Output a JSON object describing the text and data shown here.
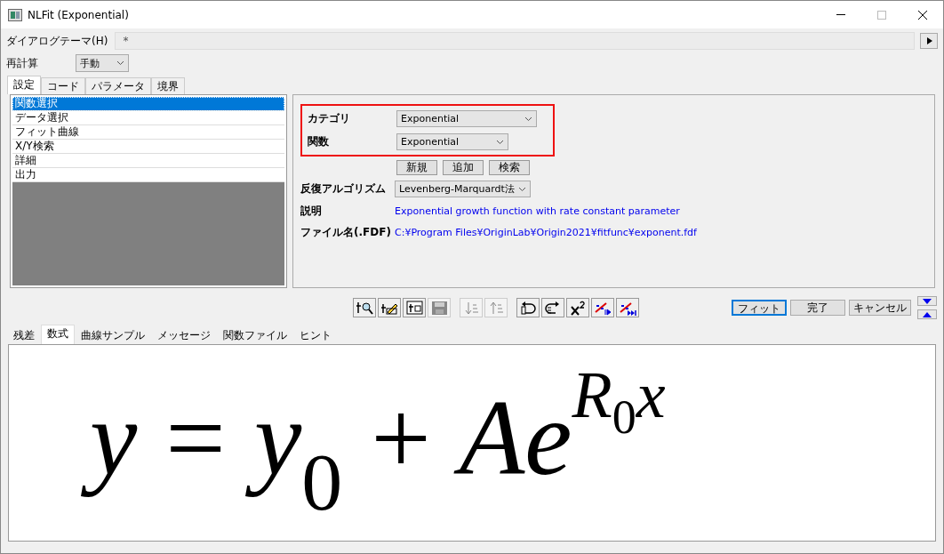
{
  "window": {
    "title": "NLFit (Exponential)"
  },
  "theme": {
    "label": "ダイアログテーマ(H)",
    "value": "*"
  },
  "recalc": {
    "label": "再計算",
    "value": "手動"
  },
  "tabs": [
    {
      "label": "設定",
      "selected": true
    },
    {
      "label": "コード",
      "selected": false
    },
    {
      "label": "パラメータ",
      "selected": false
    },
    {
      "label": "境界",
      "selected": false
    }
  ],
  "nav": [
    {
      "label": "関数選択",
      "selected": true
    },
    {
      "label": "データ選択",
      "selected": false
    },
    {
      "label": "フィット曲線",
      "selected": false
    },
    {
      "label": "X/Y検索",
      "selected": false
    },
    {
      "label": "詳細",
      "selected": false
    },
    {
      "label": "出力",
      "selected": false
    }
  ],
  "settings": {
    "category_label": "カテゴリ",
    "category": "Exponential",
    "function_label": "関数",
    "function": "Exponential",
    "buttons": [
      "新規",
      "追加",
      "検索"
    ],
    "algorithm_label": "反復アルゴリズム",
    "algorithm": "Levenberg-Marquardt法",
    "description_label": "説明",
    "description": "Exponential growth function with rate constant parameter",
    "file_label": "ファイル名(.FDF)",
    "file": "C:¥Program Files¥OriginLab¥Origin2021¥fitfunc¥exponent.fdf"
  },
  "toolbar": [
    {
      "kind": "fx-search",
      "disabled": false
    },
    {
      "kind": "fx-edit",
      "disabled": false
    },
    {
      "kind": "fx-file",
      "disabled": false
    },
    {
      "kind": "save",
      "disabled": true
    },
    {
      "kind": "sort-down",
      "disabled": true
    },
    {
      "kind": "sort-up",
      "disabled": true
    },
    {
      "kind": "undo",
      "disabled": false
    },
    {
      "kind": "redo",
      "disabled": false
    },
    {
      "kind": "chi-square",
      "disabled": false
    },
    {
      "kind": "fit-one",
      "disabled": false
    },
    {
      "kind": "fit-all",
      "disabled": false
    }
  ],
  "actions": [
    {
      "label": "フィット",
      "default": true
    },
    {
      "label": "完了",
      "default": false
    },
    {
      "label": "キャンセル",
      "default": false
    }
  ],
  "bottom_tabs": [
    {
      "label": "残差",
      "selected": false
    },
    {
      "label": "数式",
      "selected": true
    },
    {
      "label": "曲線サンプル",
      "selected": false
    },
    {
      "label": "メッセージ",
      "selected": false
    },
    {
      "label": "関数ファイル",
      "selected": false
    },
    {
      "label": "ヒント",
      "selected": false
    }
  ],
  "formula": [
    {
      "kind": "italic",
      "text": "y"
    },
    {
      "kind": "op",
      "text": "="
    },
    {
      "kind": "italic",
      "text": "y"
    },
    {
      "kind": "sub",
      "text": "0"
    },
    {
      "kind": "op",
      "text": "+"
    },
    {
      "kind": "italic",
      "text": "Ae"
    },
    {
      "kind": "sup-italic",
      "text": "R"
    },
    {
      "kind": "sup-sub",
      "text": "0"
    },
    {
      "kind": "sup-italic",
      "text": "x"
    }
  ]
}
